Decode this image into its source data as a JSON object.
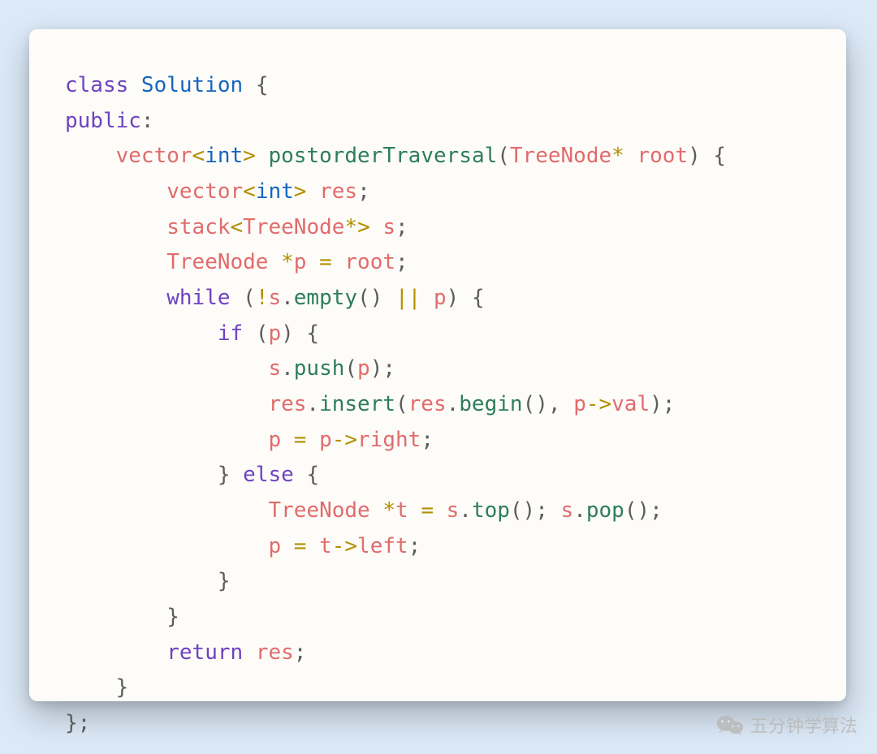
{
  "watermark": {
    "text": "五分钟学算法"
  },
  "colors": {
    "background": "#dce9f7",
    "card": "#fdfcf9",
    "keyword": "#6f42c1",
    "type": "#e06c6c",
    "name": "#1565c0",
    "func": "#2e7d5b",
    "operator": "#b38f00",
    "punct": "#5c5c5c"
  },
  "code": {
    "language": "cpp",
    "plain_text": "class Solution {\npublic:\n    vector<int> postorderTraversal(TreeNode* root) {\n        vector<int> res;\n        stack<TreeNode*> s;\n        TreeNode *p = root;\n        while (!s.empty() || p) {\n            if (p) {\n                s.push(p);\n                res.insert(res.begin(), p->val);\n                p = p->right;\n            } else {\n                TreeNode *t = s.top(); s.pop();\n                p = t->left;\n            }\n        }\n        return res;\n    }\n};",
    "lines": [
      [
        {
          "t": "class ",
          "c": "kw"
        },
        {
          "t": "Solution ",
          "c": "name"
        },
        {
          "t": "{",
          "c": "punc"
        }
      ],
      [
        {
          "t": "public",
          "c": "kw"
        },
        {
          "t": ":",
          "c": "punc"
        }
      ],
      [
        {
          "t": "    ",
          "c": ""
        },
        {
          "t": "vector",
          "c": "type"
        },
        {
          "t": "<",
          "c": "op"
        },
        {
          "t": "int",
          "c": "name"
        },
        {
          "t": "> ",
          "c": "op"
        },
        {
          "t": "postorderTraversal",
          "c": "func"
        },
        {
          "t": "(",
          "c": "punc"
        },
        {
          "t": "TreeNode",
          "c": "type"
        },
        {
          "t": "* ",
          "c": "op"
        },
        {
          "t": "root",
          "c": "type"
        },
        {
          "t": ") {",
          "c": "punc"
        }
      ],
      [
        {
          "t": "        ",
          "c": ""
        },
        {
          "t": "vector",
          "c": "type"
        },
        {
          "t": "<",
          "c": "op"
        },
        {
          "t": "int",
          "c": "name"
        },
        {
          "t": "> ",
          "c": "op"
        },
        {
          "t": "res",
          "c": "type"
        },
        {
          "t": ";",
          "c": "punc"
        }
      ],
      [
        {
          "t": "        ",
          "c": ""
        },
        {
          "t": "stack",
          "c": "type"
        },
        {
          "t": "<",
          "c": "op"
        },
        {
          "t": "TreeNode",
          "c": "type"
        },
        {
          "t": "*",
          "c": "op"
        },
        {
          "t": "> ",
          "c": "op"
        },
        {
          "t": "s",
          "c": "type"
        },
        {
          "t": ";",
          "c": "punc"
        }
      ],
      [
        {
          "t": "        ",
          "c": ""
        },
        {
          "t": "TreeNode ",
          "c": "type"
        },
        {
          "t": "*",
          "c": "op"
        },
        {
          "t": "p ",
          "c": "type"
        },
        {
          "t": "=",
          "c": "op"
        },
        {
          "t": " root",
          "c": "type"
        },
        {
          "t": ";",
          "c": "punc"
        }
      ],
      [
        {
          "t": "        ",
          "c": ""
        },
        {
          "t": "while ",
          "c": "kw"
        },
        {
          "t": "(",
          "c": "punc"
        },
        {
          "t": "!",
          "c": "op"
        },
        {
          "t": "s",
          "c": "type"
        },
        {
          "t": ".",
          "c": "punc"
        },
        {
          "t": "empty",
          "c": "func"
        },
        {
          "t": "() ",
          "c": "punc"
        },
        {
          "t": "||",
          "c": "op"
        },
        {
          "t": " p",
          "c": "type"
        },
        {
          "t": ") {",
          "c": "punc"
        }
      ],
      [
        {
          "t": "            ",
          "c": ""
        },
        {
          "t": "if ",
          "c": "kw"
        },
        {
          "t": "(",
          "c": "punc"
        },
        {
          "t": "p",
          "c": "type"
        },
        {
          "t": ") {",
          "c": "punc"
        }
      ],
      [
        {
          "t": "                ",
          "c": ""
        },
        {
          "t": "s",
          "c": "type"
        },
        {
          "t": ".",
          "c": "punc"
        },
        {
          "t": "push",
          "c": "func"
        },
        {
          "t": "(",
          "c": "punc"
        },
        {
          "t": "p",
          "c": "type"
        },
        {
          "t": ");",
          "c": "punc"
        }
      ],
      [
        {
          "t": "                ",
          "c": ""
        },
        {
          "t": "res",
          "c": "type"
        },
        {
          "t": ".",
          "c": "punc"
        },
        {
          "t": "insert",
          "c": "func"
        },
        {
          "t": "(",
          "c": "punc"
        },
        {
          "t": "res",
          "c": "type"
        },
        {
          "t": ".",
          "c": "punc"
        },
        {
          "t": "begin",
          "c": "func"
        },
        {
          "t": "(), ",
          "c": "punc"
        },
        {
          "t": "p",
          "c": "type"
        },
        {
          "t": "->",
          "c": "op"
        },
        {
          "t": "val",
          "c": "type"
        },
        {
          "t": ");",
          "c": "punc"
        }
      ],
      [
        {
          "t": "                ",
          "c": ""
        },
        {
          "t": "p ",
          "c": "type"
        },
        {
          "t": "=",
          "c": "op"
        },
        {
          "t": " p",
          "c": "type"
        },
        {
          "t": "->",
          "c": "op"
        },
        {
          "t": "right",
          "c": "type"
        },
        {
          "t": ";",
          "c": "punc"
        }
      ],
      [
        {
          "t": "            ",
          "c": ""
        },
        {
          "t": "} ",
          "c": "punc"
        },
        {
          "t": "else ",
          "c": "kw"
        },
        {
          "t": "{",
          "c": "punc"
        }
      ],
      [
        {
          "t": "                ",
          "c": ""
        },
        {
          "t": "TreeNode ",
          "c": "type"
        },
        {
          "t": "*",
          "c": "op"
        },
        {
          "t": "t ",
          "c": "type"
        },
        {
          "t": "=",
          "c": "op"
        },
        {
          "t": " s",
          "c": "type"
        },
        {
          "t": ".",
          "c": "punc"
        },
        {
          "t": "top",
          "c": "func"
        },
        {
          "t": "(); ",
          "c": "punc"
        },
        {
          "t": "s",
          "c": "type"
        },
        {
          "t": ".",
          "c": "punc"
        },
        {
          "t": "pop",
          "c": "func"
        },
        {
          "t": "();",
          "c": "punc"
        }
      ],
      [
        {
          "t": "                ",
          "c": ""
        },
        {
          "t": "p ",
          "c": "type"
        },
        {
          "t": "=",
          "c": "op"
        },
        {
          "t": " t",
          "c": "type"
        },
        {
          "t": "->",
          "c": "op"
        },
        {
          "t": "left",
          "c": "type"
        },
        {
          "t": ";",
          "c": "punc"
        }
      ],
      [
        {
          "t": "            ",
          "c": ""
        },
        {
          "t": "}",
          "c": "punc"
        }
      ],
      [
        {
          "t": "        ",
          "c": ""
        },
        {
          "t": "}",
          "c": "punc"
        }
      ],
      [
        {
          "t": "        ",
          "c": ""
        },
        {
          "t": "return ",
          "c": "kw"
        },
        {
          "t": "res",
          "c": "type"
        },
        {
          "t": ";",
          "c": "punc"
        }
      ],
      [
        {
          "t": "    ",
          "c": ""
        },
        {
          "t": "}",
          "c": "punc"
        }
      ],
      [
        {
          "t": "};",
          "c": "punc"
        }
      ]
    ]
  }
}
